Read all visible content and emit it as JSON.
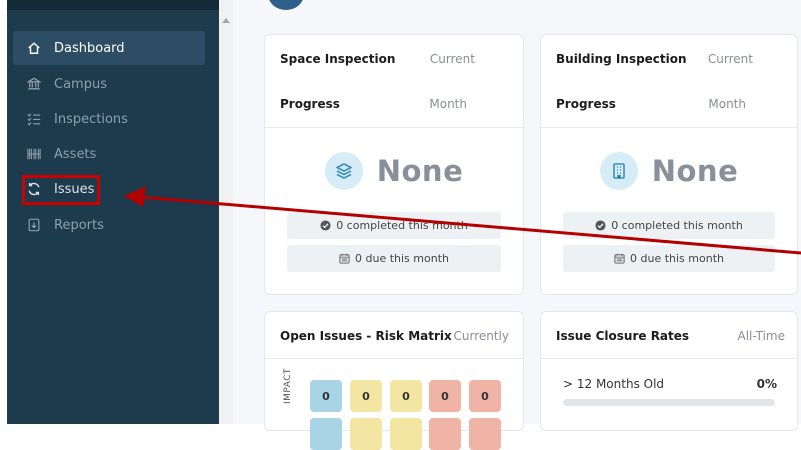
{
  "sidebar": {
    "items": [
      {
        "label": "Dashboard",
        "icon": "home-icon",
        "active": true
      },
      {
        "label": "Campus",
        "icon": "bank-icon",
        "active": false
      },
      {
        "label": "Inspections",
        "icon": "checklist-icon",
        "active": false
      },
      {
        "label": "Assets",
        "icon": "barcode-icon",
        "active": false
      },
      {
        "label": "Issues",
        "icon": "sync-icon",
        "active": false
      },
      {
        "label": "Reports",
        "icon": "report-icon",
        "active": false
      }
    ]
  },
  "cards": {
    "space": {
      "title": "Space Inspection",
      "current": "Current",
      "progress": "Progress",
      "month": "Month",
      "value": "None",
      "completed_label": "0 completed this month",
      "due_label": "0 due this month"
    },
    "building": {
      "title": "Building Inspection",
      "current": "Current",
      "progress": "Progress",
      "month": "Month",
      "value": "None",
      "completed_label": "0 completed this month",
      "due_label": "0 due this month"
    },
    "risk": {
      "title": "Open Issues - Risk Matrix",
      "period": "Currently",
      "axis_label": "IMPACT",
      "row1": [
        "0",
        "0",
        "0",
        "0",
        "0"
      ]
    },
    "closure": {
      "title": "Issue Closure Rates",
      "period": "All-Time",
      "row_label": "> 12 Months Old",
      "row_value": "0%",
      "progress": 0.0
    }
  },
  "colors": {
    "sidebar_bg": "#1e3a4d",
    "active_bg": "#2c4d63",
    "annotation": "#cc0000",
    "cell_blue": "#a8d4e6",
    "cell_yellow": "#f3e5a2",
    "cell_red": "#f0b4a6"
  }
}
